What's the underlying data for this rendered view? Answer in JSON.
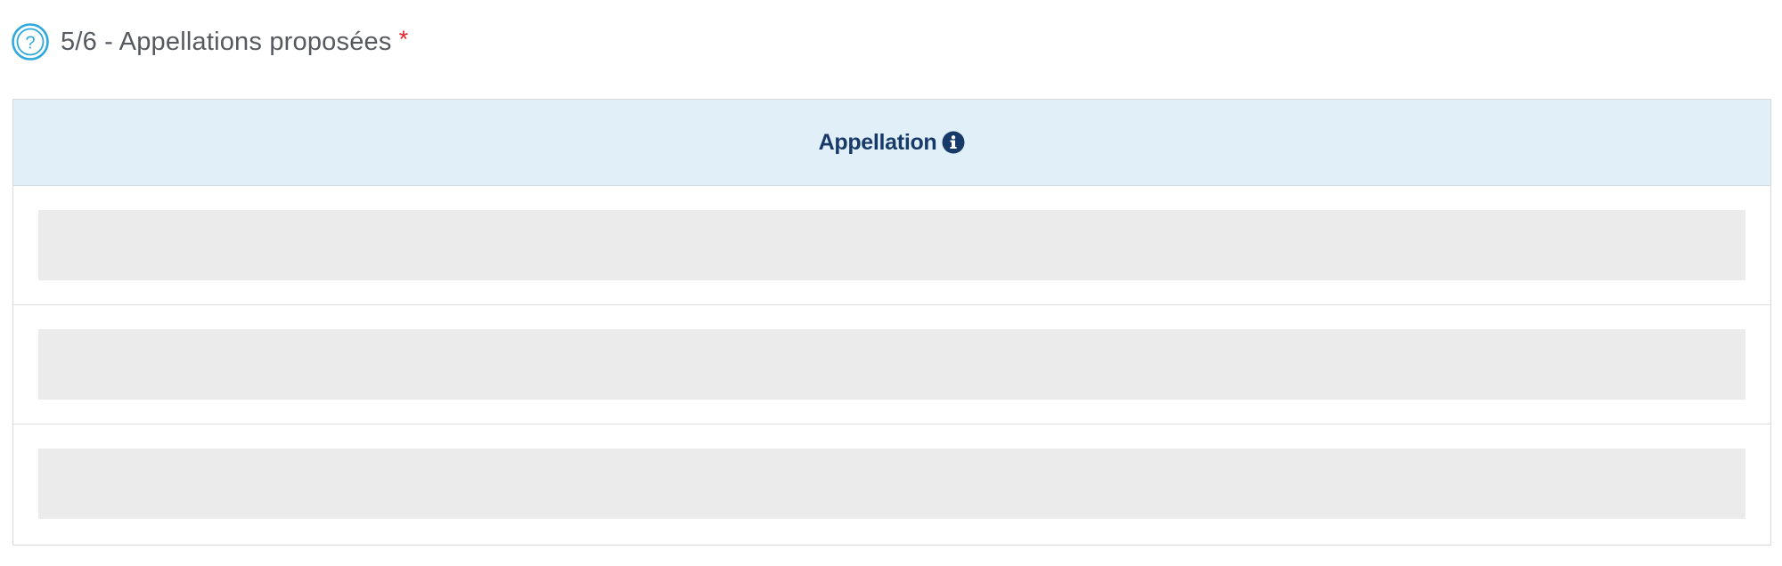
{
  "section": {
    "title": "5/6 - Appellations proposées",
    "required_marker": "*",
    "help_icon": "question-circle-icon"
  },
  "table": {
    "columns": [
      {
        "label": "Appellation",
        "icon": "info-circle-icon"
      }
    ],
    "rows": [
      {
        "value": ""
      },
      {
        "value": ""
      },
      {
        "value": ""
      }
    ]
  },
  "colors": {
    "header_background": "#e1eff8",
    "header_text": "#173a68",
    "help_icon": "#2fa8dc",
    "required": "#e3242b",
    "placeholder": "#ebebeb"
  }
}
